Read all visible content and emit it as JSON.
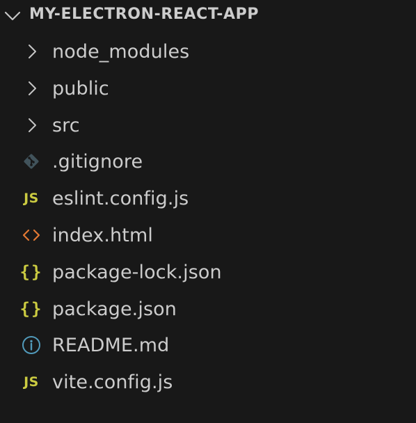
{
  "explorer": {
    "title": "MY-ELECTRON-REACT-APP",
    "chevron_color": "#c5c5c5",
    "items": [
      {
        "label": "node_modules",
        "kind": "folder",
        "icon": "chevron-right-icon"
      },
      {
        "label": "public",
        "kind": "folder",
        "icon": "chevron-right-icon"
      },
      {
        "label": "src",
        "kind": "folder",
        "icon": "chevron-right-icon"
      },
      {
        "label": ".gitignore",
        "kind": "file",
        "icon": "git-icon",
        "icon_color": "#41535b"
      },
      {
        "label": "eslint.config.js",
        "kind": "file",
        "icon": "js-icon",
        "icon_text": "JS",
        "icon_color": "#cbcb41"
      },
      {
        "label": "index.html",
        "kind": "file",
        "icon": "html-icon",
        "icon_color": "#e37933"
      },
      {
        "label": "package-lock.json",
        "kind": "file",
        "icon": "json-icon",
        "icon_text": "{}",
        "icon_color": "#cbcb41"
      },
      {
        "label": "package.json",
        "kind": "file",
        "icon": "json-icon",
        "icon_text": "{}",
        "icon_color": "#cbcb41"
      },
      {
        "label": "README.md",
        "kind": "file",
        "icon": "info-icon",
        "icon_color": "#519aba"
      },
      {
        "label": "vite.config.js",
        "kind": "file",
        "icon": "js-icon",
        "icon_text": "JS",
        "icon_color": "#cbcb41"
      }
    ]
  }
}
